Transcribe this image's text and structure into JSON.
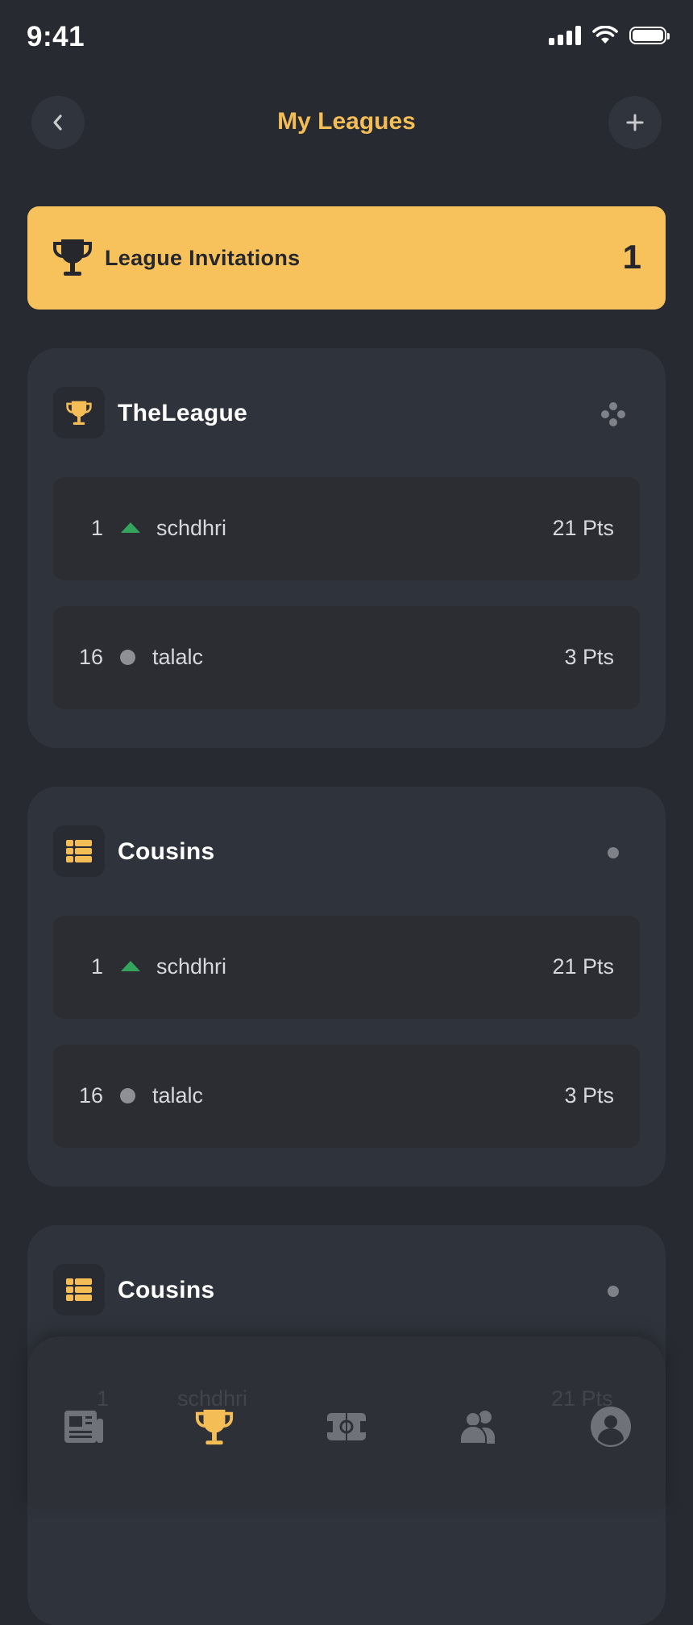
{
  "status_bar": {
    "time": "9:41"
  },
  "header": {
    "title": "My Leagues"
  },
  "invitations": {
    "label": "League Invitations",
    "count": "1"
  },
  "leagues": [
    {
      "name": "TheLeague",
      "icon": "trophy-icon",
      "rows": [
        {
          "rank": "1",
          "trend": "up",
          "user": "schdhri",
          "points": "21 Pts"
        },
        {
          "rank": "16",
          "trend": "same",
          "user": "talalc",
          "points": "3 Pts"
        }
      ]
    },
    {
      "name": "Cousins",
      "icon": "table-icon",
      "rows": [
        {
          "rank": "1",
          "trend": "up",
          "user": "schdhri",
          "points": "21 Pts"
        },
        {
          "rank": "16",
          "trend": "same",
          "user": "talalc",
          "points": "3 Pts"
        }
      ]
    },
    {
      "name": "Cousins",
      "icon": "table-icon",
      "rows": [
        {
          "rank": "1",
          "trend": "up",
          "user": "schdhri",
          "points": "21 Pts"
        }
      ]
    }
  ],
  "bottom_nav": {
    "items": [
      "news-icon",
      "trophy-icon",
      "pitch-icon",
      "friends-icon",
      "profile-icon"
    ],
    "active": "trophy-icon"
  },
  "colors": {
    "background": "#272a31",
    "card": "#2f333b",
    "row": "#2b2d32",
    "accent": "#f4bd55",
    "banner": "#f7c25c",
    "trend_up": "#35a45c",
    "trend_same": "#8e9096"
  }
}
